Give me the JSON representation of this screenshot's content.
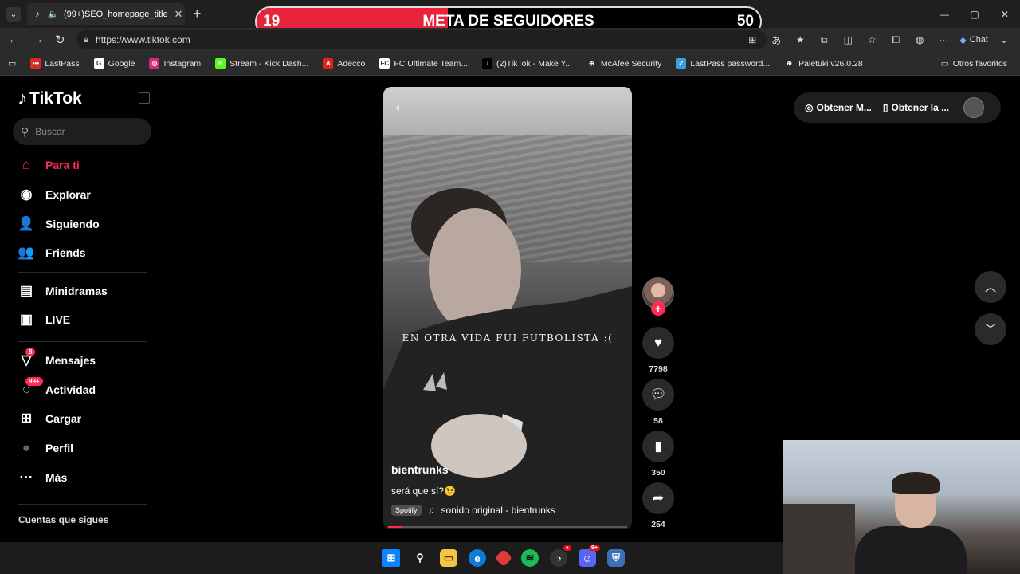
{
  "browser": {
    "tab_title": "(99+)SEO_homepage_title",
    "tab_close": "✕",
    "new_tab": "+",
    "url": "https://www.tiktok.com",
    "chat_label": "Chat",
    "window": {
      "minimize": "—",
      "maximize": "▢",
      "close": "✕"
    }
  },
  "overlay": {
    "current": "19",
    "title": "META DE SEGUIDORES",
    "goal": "50",
    "progress": 0.38,
    "fill_color": "#e8233b"
  },
  "bookmarks": [
    {
      "label": "LastPass",
      "icon": "lastpass-icon",
      "glyph": "•••",
      "color": "#d32d27"
    },
    {
      "label": "Google",
      "icon": "google-icon",
      "glyph": "G",
      "color": "#ffffff"
    },
    {
      "label": "Instagram",
      "icon": "instagram-icon",
      "glyph": "◎",
      "color": "#d62976"
    },
    {
      "label": "Stream - Kick Dash...",
      "icon": "kick-icon",
      "glyph": "K",
      "color": "#53fc18"
    },
    {
      "label": "Adecco",
      "icon": "adecco-icon",
      "glyph": "A",
      "color": "#e2231a"
    },
    {
      "label": "FC Ultimate Team...",
      "icon": "fc-icon",
      "glyph": "FC",
      "color": "#ffffff"
    },
    {
      "label": "(2)TikTok - Make Y...",
      "icon": "tiktok-icon",
      "glyph": "♪",
      "color": "#000000"
    },
    {
      "label": "McAfee Security",
      "icon": "globe-icon",
      "glyph": "⊕",
      "color": "#2b2b2b"
    },
    {
      "label": "LastPass password...",
      "icon": "lastpass-pw-icon",
      "glyph": "✓",
      "color": "#3aa0e0"
    },
    {
      "label": "Paletuki v26.0.28",
      "icon": "globe-icon",
      "glyph": "⊕",
      "color": "#2b2b2b"
    }
  ],
  "otros_favoritos": "Otros favoritos",
  "sidebar": {
    "brand": "TikTok",
    "search_placeholder": "Buscar",
    "items": [
      {
        "label": "Para ti",
        "icon": "home-icon",
        "glyph": "⌂"
      },
      {
        "label": "Explorar",
        "icon": "compass-icon",
        "glyph": "◉"
      },
      {
        "label": "Siguiendo",
        "icon": "following-icon",
        "glyph": "👤"
      },
      {
        "label": "Friends",
        "icon": "friends-icon",
        "glyph": "👥"
      },
      {
        "label": "Minidramas",
        "icon": "minidramas-icon",
        "glyph": "▤"
      },
      {
        "label": "LIVE",
        "icon": "live-icon",
        "glyph": "▣"
      },
      {
        "label": "Mensajes",
        "icon": "messages-icon",
        "glyph": "▽",
        "badge": "8"
      },
      {
        "label": "Actividad",
        "icon": "activity-icon",
        "glyph": "◌",
        "badge": "99+"
      },
      {
        "label": "Cargar",
        "icon": "upload-icon",
        "glyph": "⊞"
      },
      {
        "label": "Perfil",
        "icon": "profile-avatar",
        "glyph": "●"
      },
      {
        "label": "Más",
        "icon": "more-icon",
        "glyph": "···"
      }
    ],
    "following_title": "Cuentas que sigues"
  },
  "video": {
    "caption": "EN OTRA VIDA FUI FUTBOLISTA :(",
    "username": "bientrunks",
    "description": "será que sí?😉",
    "music_badge": "Spotify",
    "music": "sonido original - bientrunks",
    "progress": 0.06
  },
  "actions": {
    "likes": "7798",
    "comments": "58",
    "saves": "350",
    "shares": "254"
  },
  "getbar": {
    "app1": "Obtener M...",
    "app2": "Obtener la ..."
  }
}
